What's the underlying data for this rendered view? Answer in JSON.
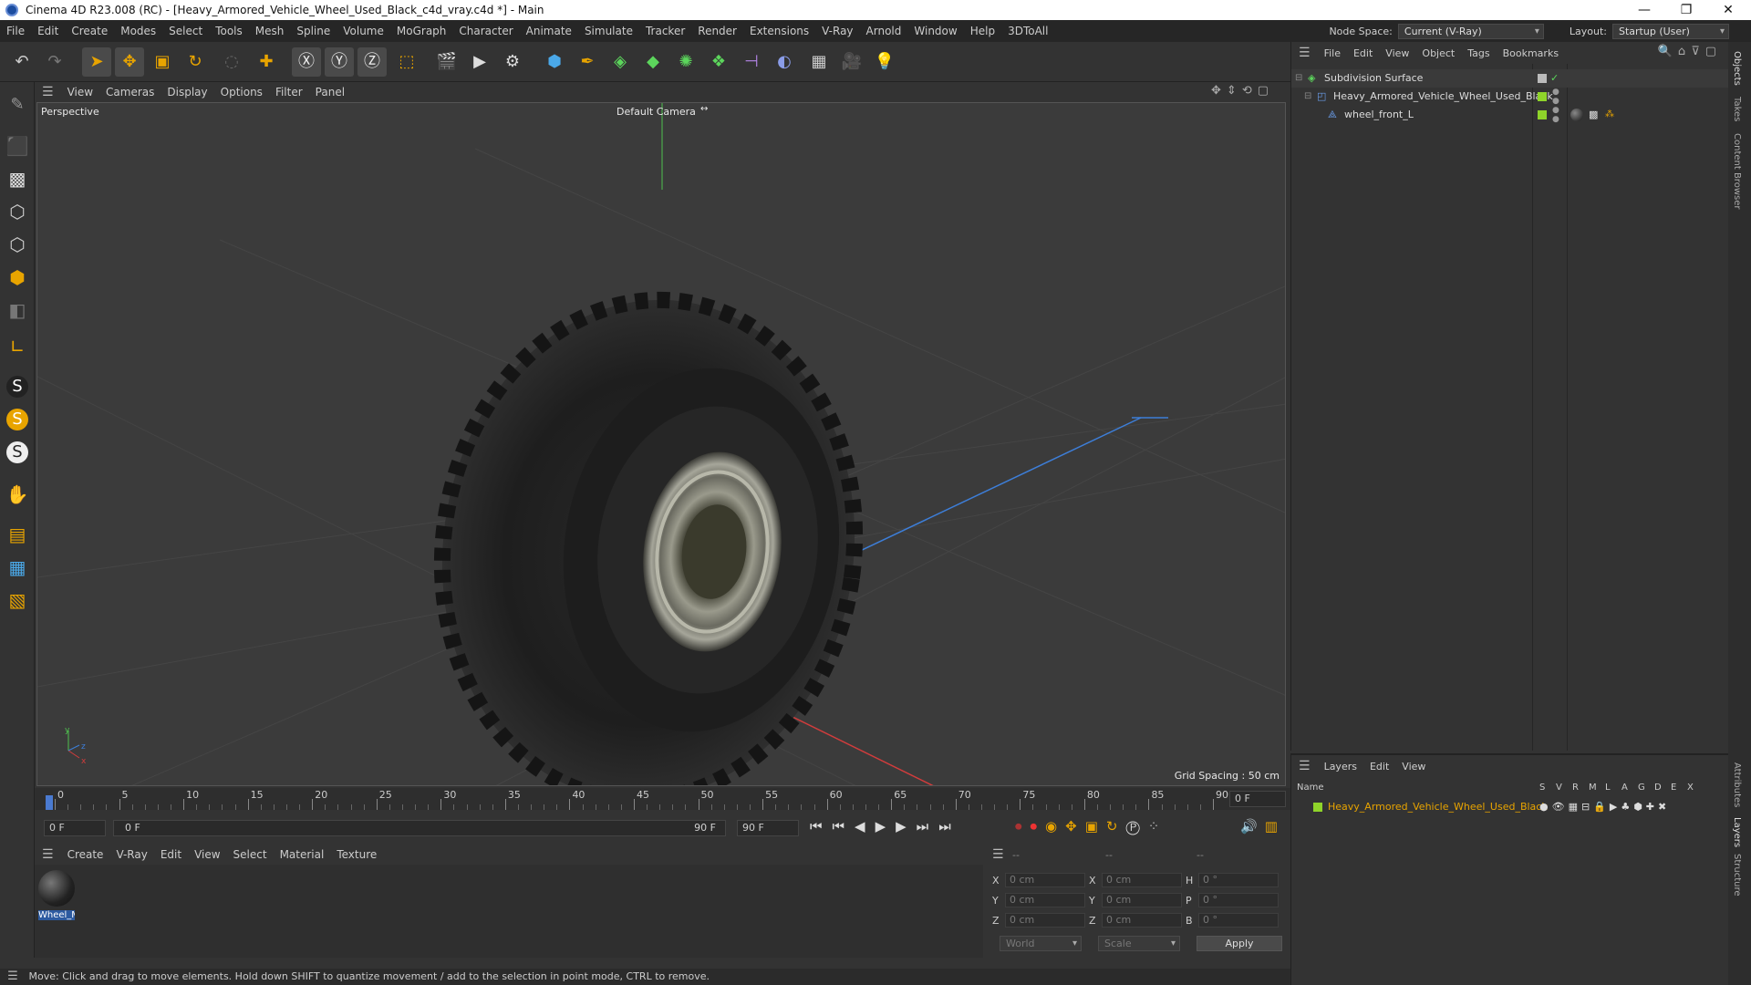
{
  "window": {
    "title": "Cinema 4D R23.008 (RC) - [Heavy_Armored_Vehicle_Wheel_Used_Black_c4d_vray.c4d *] - Main"
  },
  "menubar": {
    "items": [
      "File",
      "Edit",
      "Create",
      "Modes",
      "Select",
      "Tools",
      "Mesh",
      "Spline",
      "Volume",
      "MoGraph",
      "Character",
      "Animate",
      "Simulate",
      "Tracker",
      "Render",
      "Extensions",
      "V-Ray",
      "Arnold",
      "Window",
      "Help",
      "3DToAll"
    ],
    "node_space_label": "Node Space:",
    "node_space_value": "Current (V-Ray)",
    "layout_label": "Layout:",
    "layout_value": "Startup (User)"
  },
  "viewport": {
    "menu": [
      "View",
      "Cameras",
      "Display",
      "Options",
      "Filter",
      "Panel"
    ],
    "view_name": "Perspective",
    "camera": "Default Camera",
    "grid_spacing": "Grid Spacing : 50 cm"
  },
  "timeline": {
    "ticks": [
      "0",
      "5",
      "10",
      "15",
      "20",
      "25",
      "30",
      "35",
      "40",
      "45",
      "50",
      "55",
      "60",
      "65",
      "70",
      "75",
      "80",
      "85",
      "90"
    ],
    "frame_end_field": "0 F",
    "start_field": "0 F",
    "range_start": "0 F",
    "range_end": "90 F",
    "end_field": "90 F"
  },
  "material_manager": {
    "menu": [
      "Create",
      "V-Ray",
      "Edit",
      "View",
      "Select",
      "Material",
      "Texture"
    ],
    "materials": [
      {
        "name": "Wheel_M"
      }
    ]
  },
  "coordinates": {
    "headers": [
      "--",
      "--",
      "--"
    ],
    "rows": [
      {
        "a_label": "X",
        "a_val": "0 cm",
        "b_label": "X",
        "b_val": "0 cm",
        "c_label": "H",
        "c_val": "0 °"
      },
      {
        "a_label": "Y",
        "a_val": "0 cm",
        "b_label": "Y",
        "b_val": "0 cm",
        "c_label": "P",
        "c_val": "0 °"
      },
      {
        "a_label": "Z",
        "a_val": "0 cm",
        "b_label": "Z",
        "b_val": "0 cm",
        "c_label": "B",
        "c_val": "0 °"
      }
    ],
    "space": "World",
    "mode": "Scale",
    "apply": "Apply"
  },
  "status": "Move: Click and drag to move elements. Hold down SHIFT to quantize movement / add to the selection in point mode, CTRL to remove.",
  "object_manager": {
    "menu": [
      "File",
      "Edit",
      "View",
      "Object",
      "Tags",
      "Bookmarks"
    ],
    "objects": [
      {
        "name": "Subdivision Surface"
      },
      {
        "name": "Heavy_Armored_Vehicle_Wheel_Used_Black"
      },
      {
        "name": "wheel_front_L"
      }
    ]
  },
  "layer_manager": {
    "menu": [
      "Layers",
      "Edit",
      "View"
    ],
    "name_header": "Name",
    "flag_headers": [
      "S",
      "V",
      "R",
      "M",
      "L",
      "A",
      "G",
      "D",
      "E",
      "X"
    ],
    "layers": [
      {
        "name": "Heavy_Armored_Vehicle_Wheel_Used_Black",
        "color": "#8fd42a"
      }
    ]
  },
  "side_tabs": [
    "Objects",
    "Takes",
    "Content Browser",
    "Attributes",
    "Layers",
    "Structure"
  ],
  "colors": {
    "accent_green": "#8fd42a",
    "layer_orange": "#e8a400",
    "axis_x": "#d23c3c",
    "axis_y": "#4fc24f",
    "axis_z": "#3d7ed8"
  }
}
